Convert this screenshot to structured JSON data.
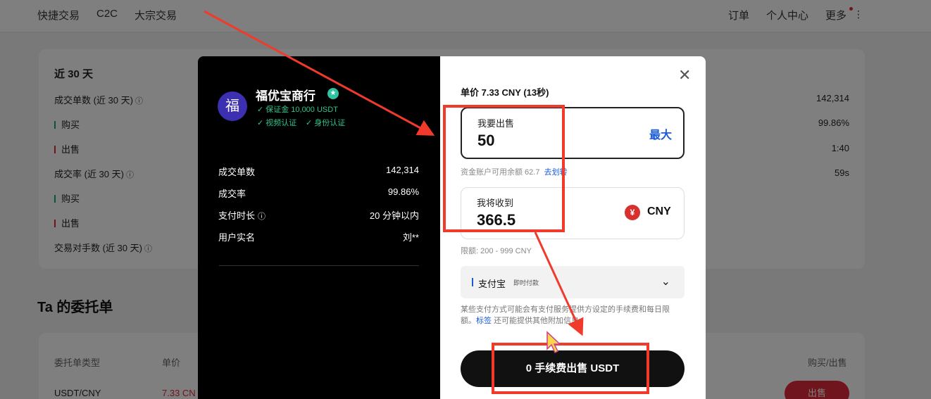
{
  "nav": {
    "left": [
      "快捷交易",
      "C2C",
      "大宗交易"
    ],
    "right": [
      "订单",
      "个人中心",
      "更多"
    ]
  },
  "stats": {
    "period_title": "近 30 天",
    "rows": [
      {
        "label": "成交单数 (近 30 天)",
        "value": "142,314"
      },
      {
        "label": "购买",
        "value": "99.86%"
      },
      {
        "label": "出售",
        "value": "1:40"
      },
      {
        "label": "成交率 (近 30 天)",
        "value": "59s"
      },
      {
        "label": "购买",
        "value": ""
      },
      {
        "label": "出售",
        "value": ""
      },
      {
        "label": "交易对手数 (近 30 天)",
        "value": ""
      }
    ]
  },
  "orders": {
    "title": "Ta 的委托单",
    "col_type": "委托单类型",
    "col_price": "单价",
    "col_action": "购买/出售",
    "row_type": "USDT/CNY",
    "row_price": "7.33 CN",
    "row_action": "出售"
  },
  "merchant": {
    "avatar_char": "福",
    "name": "福优宝商行",
    "deposit": "保证金 10,000 USDT",
    "video_verified": "视频认证",
    "id_verified": "身份认证",
    "stats": [
      {
        "label": "成交单数",
        "value": "142,314"
      },
      {
        "label": "成交率",
        "value": "99.86%"
      },
      {
        "label": "支付时长",
        "value": "20 分钟以内"
      },
      {
        "label": "用户实名",
        "value": "刘**"
      }
    ]
  },
  "trade": {
    "unit_price": "单价 7.33 CNY (13秒)",
    "sell_label": "我要出售",
    "sell_value": "50",
    "max_label": "最大",
    "balance_hint": "资金账户可用余额 62.7",
    "transfer_link": "去划转",
    "receive_label": "我将收到",
    "receive_value": "366.5",
    "currency_symbol": "¥",
    "currency": "CNY",
    "limit_hint": "限额: 200 - 999 CNY",
    "payment_method": "支付宝",
    "payment_sub": "即时付款",
    "notice_a": "某些支付方式可能会有支付服务提供方设定的手续费和每日限额。",
    "notice_link": "标签",
    "notice_b": "还可能提供其他附加信息。",
    "submit_label": "0 手续费出售 USDT"
  },
  "colors": {
    "accent_blue": "#1a5bd8",
    "annotation_red": "#f03a2c",
    "verify_green": "#2ec48a",
    "sell_red": "#e0293a"
  }
}
